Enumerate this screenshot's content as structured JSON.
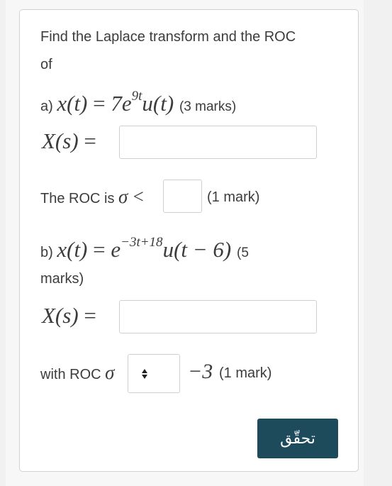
{
  "question": {
    "prompt_line1": "Find the Laplace transform and the ROC",
    "prompt_line2": "of",
    "part_a": {
      "label": "a)",
      "lhs": "x(t)",
      "equals": "=",
      "rhs_base": "7e",
      "rhs_exp": "9t",
      "rhs_tail": "u(t)",
      "marks": "(3 marks)",
      "xs_label": "X(s)",
      "xs_equals": "=",
      "xs_value": "",
      "roc_prefix": "The ROC is",
      "roc_sigma": "σ",
      "roc_op": "<",
      "roc_value": "",
      "roc_marks": "(1 mark)"
    },
    "part_b": {
      "label": "b)",
      "lhs": "x(t)",
      "equals": "=",
      "rhs_base": "e",
      "rhs_exp": "−3t+18",
      "rhs_tail": "u(t − 6)",
      "marks_part1": "(5",
      "marks_part2": "marks)",
      "xs_label": "X(s)",
      "xs_equals": "=",
      "xs_value": "",
      "roc_prefix": "with ROC",
      "roc_sigma": "σ",
      "roc_select_value": "",
      "roc_select_icon": "up-down-arrows-icon",
      "roc_value": "−3",
      "roc_marks": "(1 mark)"
    }
  },
  "check_button": {
    "label": "تحقّق",
    "color": "#1d4b5c"
  }
}
